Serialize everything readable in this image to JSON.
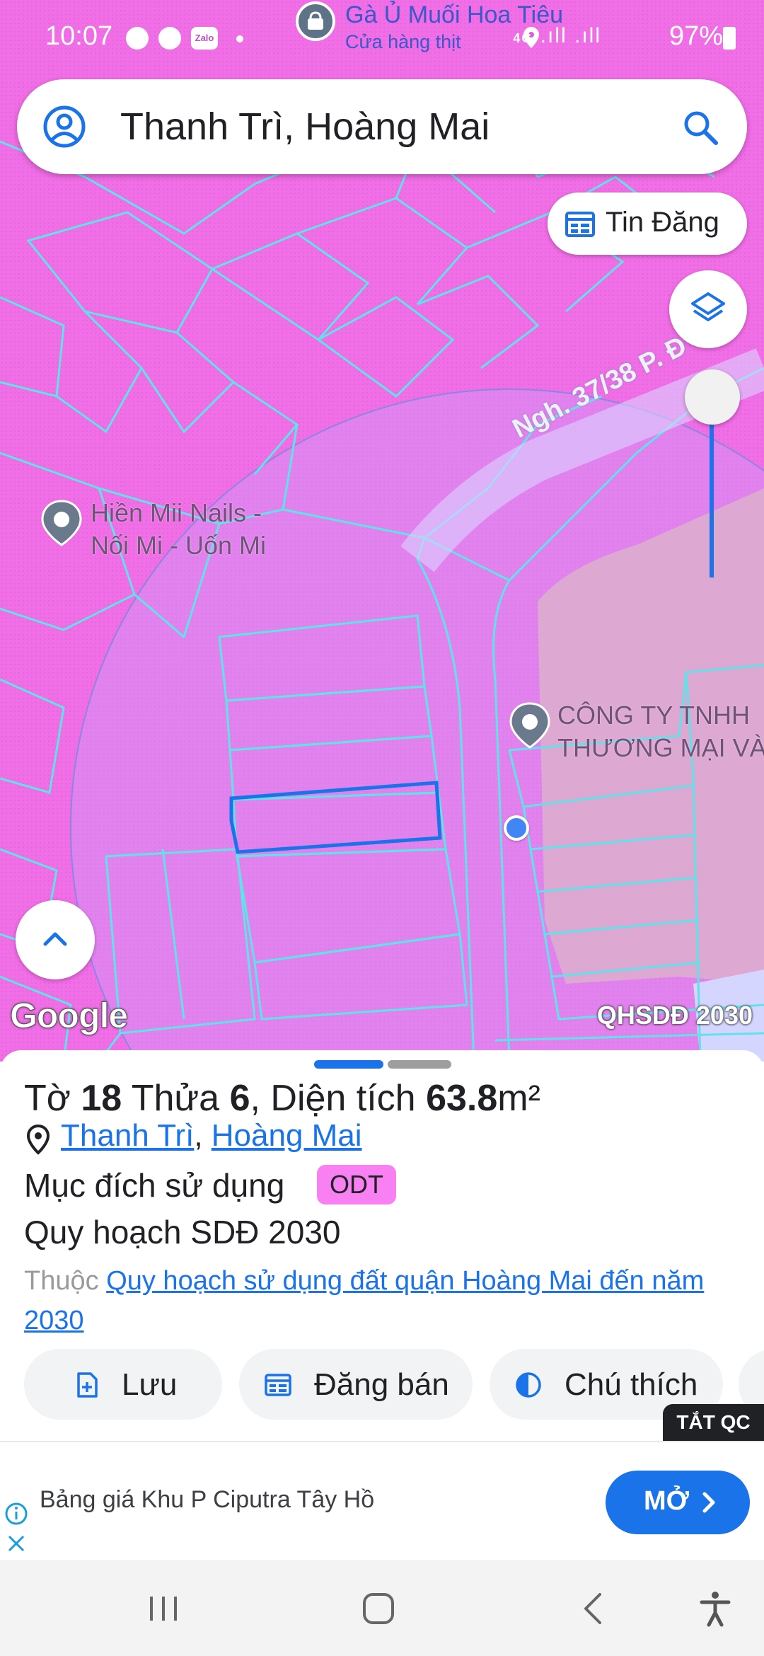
{
  "status_bar": {
    "time": "10:07",
    "apps": [
      "messenger-icon",
      "messenger-icon",
      "Zalo"
    ],
    "network": "4G",
    "battery": "97%"
  },
  "map": {
    "top_poi": {
      "name": "Gà Ủ Muối Hoa Tiêu",
      "category": "Cửa hàng thịt"
    },
    "search": {
      "text": "Thanh Trì, Hoàng Mai"
    },
    "tin_dang_label": "Tin Đăng",
    "street_label": "Ngh. 37/38 P. Đ",
    "pois": [
      {
        "line1": "Hiền Mii Nails -",
        "line2": "Nối Mi - Uốn Mi"
      },
      {
        "line1": "CÔNG TY TNHH",
        "line2": "THƯƠNG MẠI VÀ"
      }
    ],
    "attribution": "Google",
    "layer_name": "QHSDĐ 2030",
    "colors": {
      "residential": "#f06ee6",
      "lot_lines": "#5fe3e8",
      "commercial": "#e9a8b8",
      "selected": "#1a73e8"
    }
  },
  "sheet": {
    "title_parts": {
      "to_label": "Tờ",
      "to_value": "18",
      "thua_label": "Thửa",
      "thua_value": "6",
      "area_label": "Diện tích",
      "area_value": "63.8",
      "area_unit": "m²"
    },
    "location": {
      "district": "Thanh Trì",
      "city": "Hoàng Mai"
    },
    "purpose_label": "Mục đích sử dụng",
    "purpose_code": "ODT",
    "plan_label": "Quy hoạch SDĐ 2030",
    "belongs_prefix": "Thuộc",
    "belongs_link": "Quy hoạch sử dụng đất quận Hoàng Mai đến năm 2030",
    "actions": [
      {
        "label": "Lưu",
        "icon": "save-file-icon"
      },
      {
        "label": "Đăng bán",
        "icon": "listing-icon"
      },
      {
        "label": "Chú thích",
        "icon": "legend-icon"
      }
    ],
    "ads_off_label": "TẮT QC"
  },
  "ad": {
    "text": "Bảng giá Khu P Ciputra Tây Hồ",
    "button_label": "MỞ"
  }
}
